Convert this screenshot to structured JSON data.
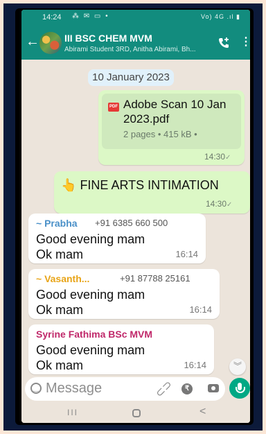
{
  "status_bar": {
    "time": "14:24",
    "left_icons": "⁂ ✉ ▭ •",
    "right_icons": "Vo) 4G .ıl ▮"
  },
  "header": {
    "title": "III BSC CHEM MVM",
    "members": "Abirami Student 3RD, Anitha Abirami, Bh..."
  },
  "chat": {
    "date": "10 January 2023",
    "document": {
      "badge": "PDF",
      "name": "Adobe Scan 10 Jan 2023.pdf",
      "meta": "2 pages • 415 kB •",
      "time": "14:30"
    },
    "fine_arts": {
      "emoji": "👆",
      "text": "FINE ARTS INTIMATION",
      "time": "14:30"
    },
    "incoming": [
      {
        "sender": "~ Prabha",
        "phone": "+91 6385 660 500",
        "color": "#4a90c8",
        "line1": "Good evening mam",
        "line2": "Ok mam",
        "time": "16:14"
      },
      {
        "sender": "~ Vasanth...",
        "phone": "+91 87788 25161",
        "color": "#e8a417",
        "line1": "Good evening mam",
        "line2": "Ok mam",
        "time": "16:14"
      },
      {
        "sender": "Syrine Fathima BSc MVM",
        "phone": "",
        "color": "#c0286a",
        "line1": "Good evening mam",
        "line2": "Ok mam",
        "time": "16:14"
      }
    ]
  },
  "composer": {
    "placeholder": "Message"
  },
  "nav": {
    "recents": "III",
    "back": "<"
  },
  "colors": {
    "header": "#128c7e",
    "outgoing": "#dcf8c6",
    "incoming": "#ffffff",
    "chat_bg": "#ece4db",
    "mic": "#00a884"
  },
  "icons": [
    "back-arrow-icon",
    "add-call-icon",
    "more-vert-icon",
    "pdf-icon",
    "check-icon",
    "emoji-icon",
    "attach-icon",
    "rupee-icon",
    "camera-icon",
    "mic-icon",
    "scroll-down-icon"
  ]
}
